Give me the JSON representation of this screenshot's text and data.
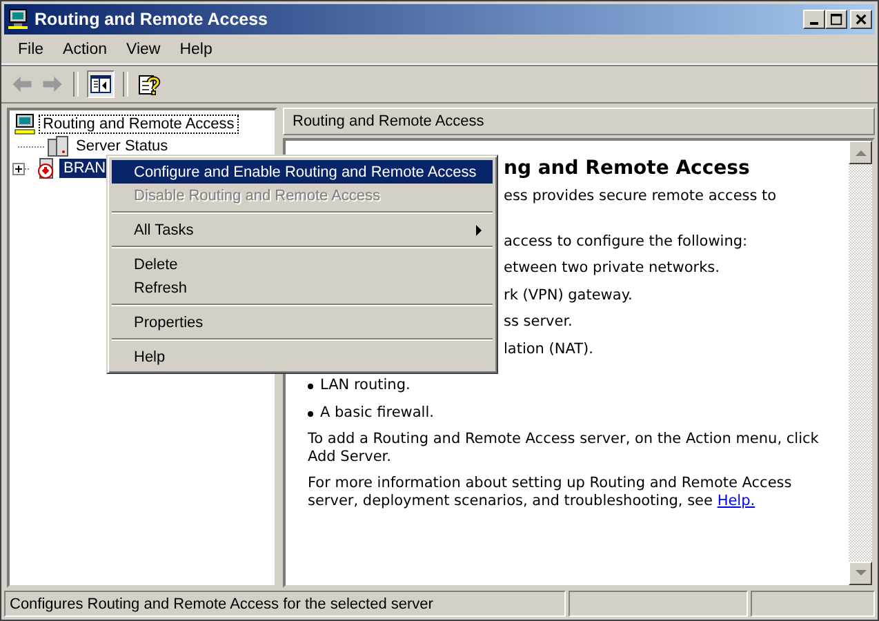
{
  "window": {
    "title": "Routing and Remote Access"
  },
  "menu_bar": [
    {
      "label": "File"
    },
    {
      "label": "Action"
    },
    {
      "label": "View"
    },
    {
      "label": "Help"
    }
  ],
  "toolbar": [
    {
      "kind": "back",
      "disabled": true
    },
    {
      "kind": "forward",
      "disabled": true
    },
    {
      "kind": "separator"
    },
    {
      "kind": "tree-toggle",
      "pressed": true
    },
    {
      "kind": "separator"
    },
    {
      "kind": "help",
      "disabled": false
    }
  ],
  "tree": [
    {
      "label": "Routing and Remote Access",
      "kind": "root",
      "selected": false,
      "focused": true,
      "children": [
        {
          "label": "Server Status",
          "kind": "status",
          "selected": false,
          "focused": false
        },
        {
          "label": "BRAN",
          "kind": "server",
          "selected": true,
          "focused": false,
          "expanded": false
        }
      ]
    }
  ],
  "pane_header": "Routing and Remote Access",
  "content": [
    {
      "kind": "heading-cut",
      "text": "ng and Remote Access"
    },
    {
      "kind": "cut",
      "text": "ess provides secure remote access to"
    },
    {
      "kind": "cut-gap",
      "text": "access to configure the following:"
    },
    {
      "kind": "cut",
      "text": "etween two private networks."
    },
    {
      "kind": "cut",
      "text": "rk (VPN) gateway."
    },
    {
      "kind": "cut",
      "text": "ss server."
    },
    {
      "kind": "cut",
      "text": "lation (NAT)."
    },
    {
      "kind": "bullet",
      "text": "LAN routing."
    },
    {
      "kind": "bullet",
      "text": "A basic firewall."
    },
    {
      "kind": "para",
      "text": "To add a Routing and Remote Access server, on the Action menu, click Add Server."
    },
    {
      "kind": "para",
      "text": "For more information about setting up Routing and Remote Access server, deployment scenarios, and troubleshooting, see ",
      "link": "Help."
    }
  ],
  "context_menu": [
    {
      "kind": "item",
      "label": "Configure and Enable Routing and Remote Access",
      "selected": true,
      "disabled": false
    },
    {
      "kind": "item",
      "label": "Disable Routing and Remote Access",
      "selected": false,
      "disabled": true
    },
    {
      "kind": "separator"
    },
    {
      "kind": "submenu",
      "label": "All Tasks",
      "selected": false,
      "disabled": false
    },
    {
      "kind": "separator"
    },
    {
      "kind": "item",
      "label": "Delete",
      "selected": false,
      "disabled": false
    },
    {
      "kind": "item",
      "label": "Refresh",
      "selected": false,
      "disabled": false
    },
    {
      "kind": "separator"
    },
    {
      "kind": "item",
      "label": "Properties",
      "selected": false,
      "disabled": false
    },
    {
      "kind": "separator"
    },
    {
      "kind": "item",
      "label": "Help",
      "selected": false,
      "disabled": false
    }
  ],
  "status_bar": [
    "Configures Routing and Remote Access for the selected server"
  ]
}
